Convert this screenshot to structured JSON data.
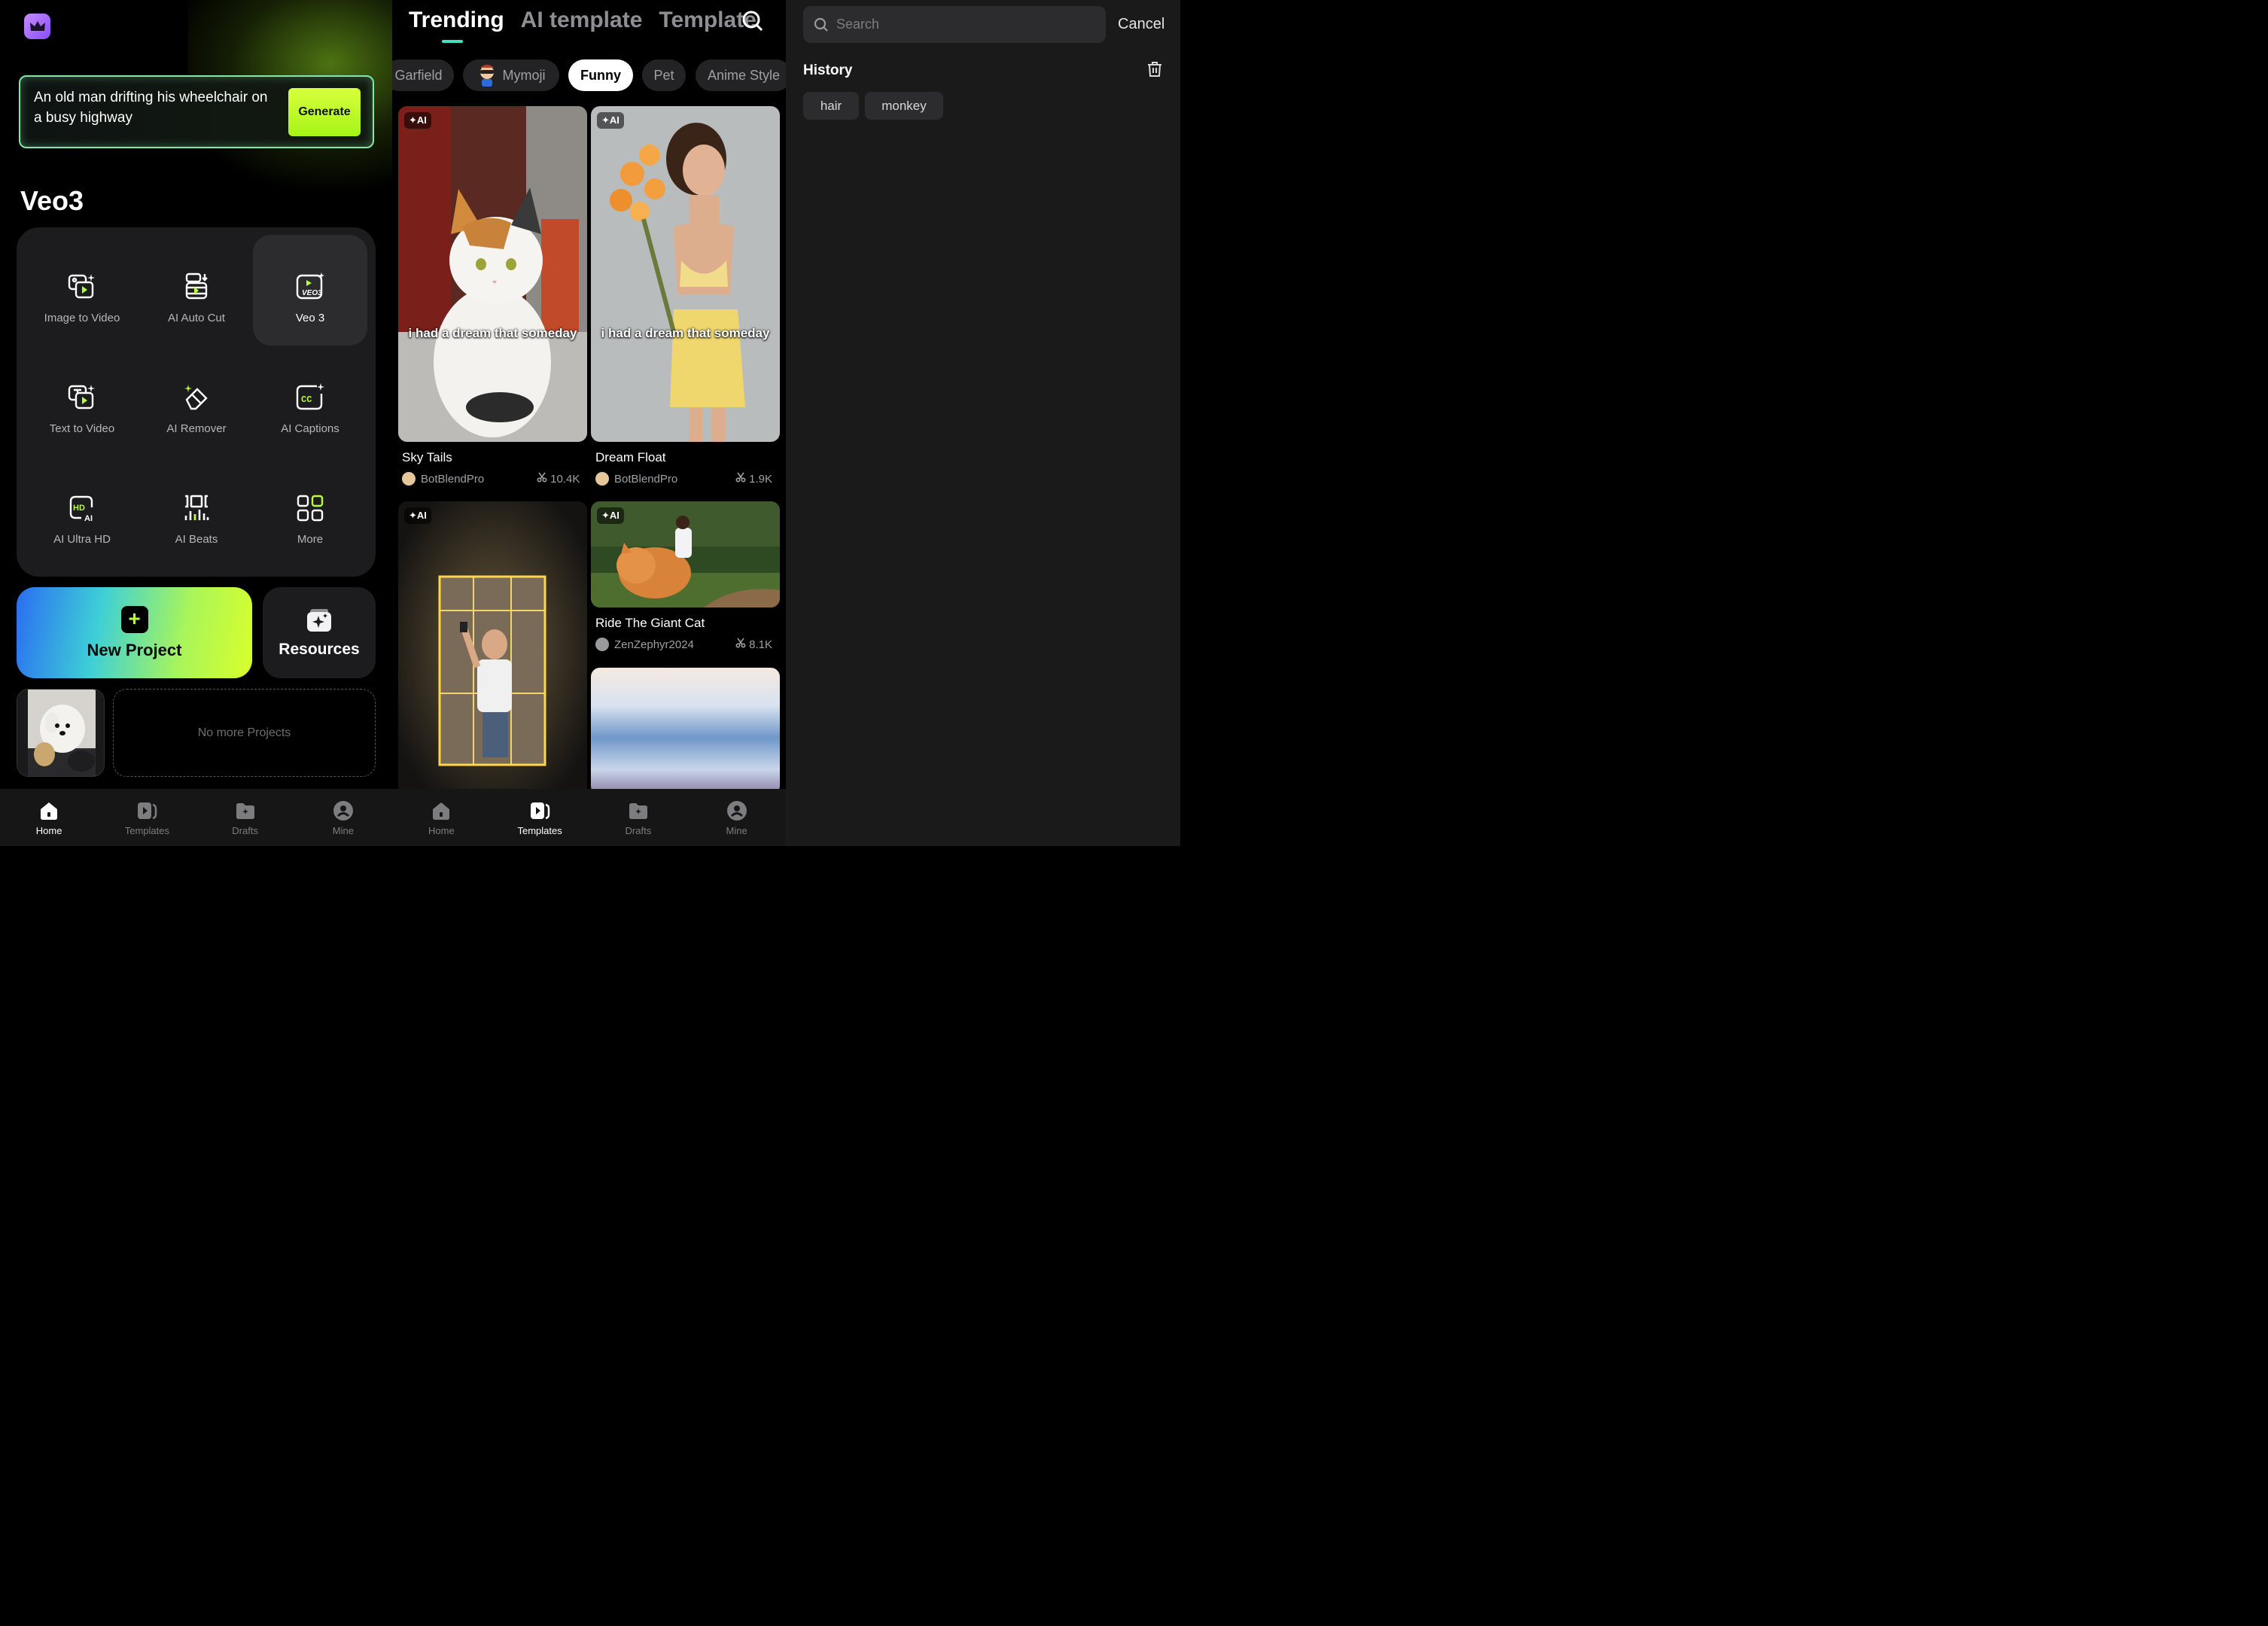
{
  "home": {
    "prompt_text": "An old man drifting his wheelchair on a busy highway",
    "generate_label": "Generate",
    "section_title": "Veo3",
    "tools": [
      {
        "label": "Image to Video",
        "icon": "image-to-video-icon"
      },
      {
        "label": "AI Auto Cut",
        "icon": "auto-cut-icon"
      },
      {
        "label": "Veo 3",
        "icon": "veo3-icon"
      },
      {
        "label": "Text to Video",
        "icon": "text-to-video-icon"
      },
      {
        "label": "AI Remover",
        "icon": "eraser-icon"
      },
      {
        "label": "AI Captions",
        "icon": "captions-icon"
      },
      {
        "label": "AI Ultra HD",
        "icon": "hd-icon"
      },
      {
        "label": "AI Beats",
        "icon": "beats-icon"
      },
      {
        "label": "More",
        "icon": "grid-icon"
      }
    ],
    "new_project_label": "New Project",
    "resources_label": "Resources",
    "no_projects_text": "No more Projects"
  },
  "nav_left": [
    {
      "label": "Home",
      "active": true
    },
    {
      "label": "Templates",
      "active": false
    },
    {
      "label": "Drafts",
      "active": false
    },
    {
      "label": "Mine",
      "active": false
    }
  ],
  "templates": {
    "tabs": [
      "Trending",
      "AI template",
      "Template"
    ],
    "active_tab": "Trending",
    "chips": [
      "Garfield",
      "Mymoji",
      "Funny",
      "Pet",
      "Anime Style"
    ],
    "active_chip": "Funny",
    "cards": [
      {
        "badge": "✦AI",
        "caption": "i had a dream that someday",
        "title": "Sky Tails",
        "author": "BotBlendPro",
        "uses": "10.4K"
      },
      {
        "badge": "✦AI",
        "caption": "i had a dream that someday",
        "title": "Dream Float",
        "author": "BotBlendPro",
        "uses": "1.9K"
      },
      {
        "badge": "✦AI",
        "title": "Ride The Giant Cat",
        "author": "ZenZephyr2024",
        "uses": "8.1K"
      },
      {
        "badge": "✦AI"
      }
    ]
  },
  "nav_right": [
    {
      "label": "Home",
      "active": false
    },
    {
      "label": "Templates",
      "active": true
    },
    {
      "label": "Drafts",
      "active": false
    },
    {
      "label": "Mine",
      "active": false
    }
  ],
  "search": {
    "placeholder": "Search",
    "cancel_label": "Cancel",
    "history_title": "History",
    "history": [
      "hair",
      "monkey"
    ]
  },
  "colors": {
    "accent_green": "#a6f516",
    "tab_underline": "#43e0c0",
    "crown_purple": "#a66cff"
  }
}
